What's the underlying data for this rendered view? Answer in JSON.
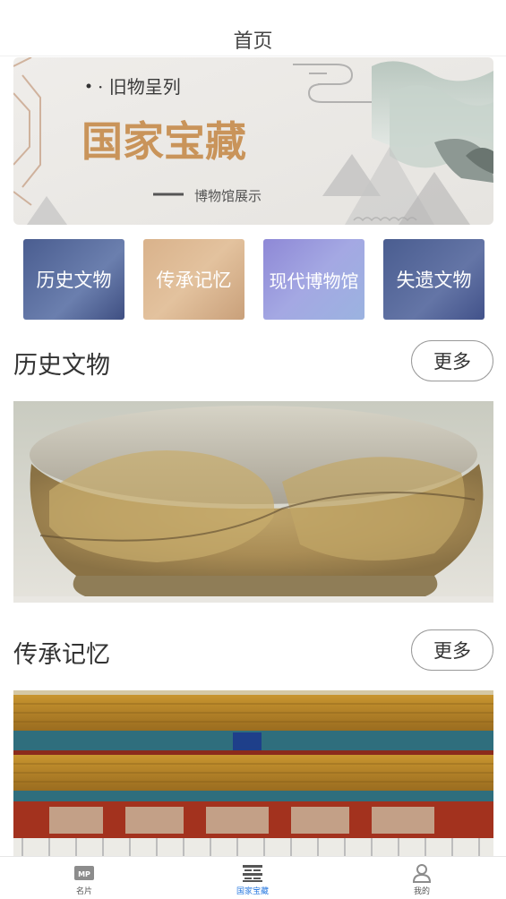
{
  "nav": {
    "title": "首页"
  },
  "banner": {
    "tag": "· 旧物呈列",
    "headline": "国家宝藏",
    "caption": "博物馆展示"
  },
  "categories": [
    {
      "label": "历史文物"
    },
    {
      "label": "传承记忆"
    },
    {
      "label": "现代博物馆"
    },
    {
      "label": "失遗文物"
    }
  ],
  "sections": [
    {
      "title": "历史文物",
      "more_label": "更多"
    },
    {
      "title": "传承记忆",
      "more_label": "更多"
    }
  ],
  "tabbar": {
    "items": [
      {
        "label": "名片",
        "icon": "mp-card-icon",
        "active": false
      },
      {
        "label": "国家宝藏",
        "icon": "treasure-icon",
        "active": true
      },
      {
        "label": "我的",
        "icon": "user-icon",
        "active": false
      }
    ]
  },
  "colors": {
    "accent": "#2f7de1",
    "headline_gold": "#c9945a"
  }
}
